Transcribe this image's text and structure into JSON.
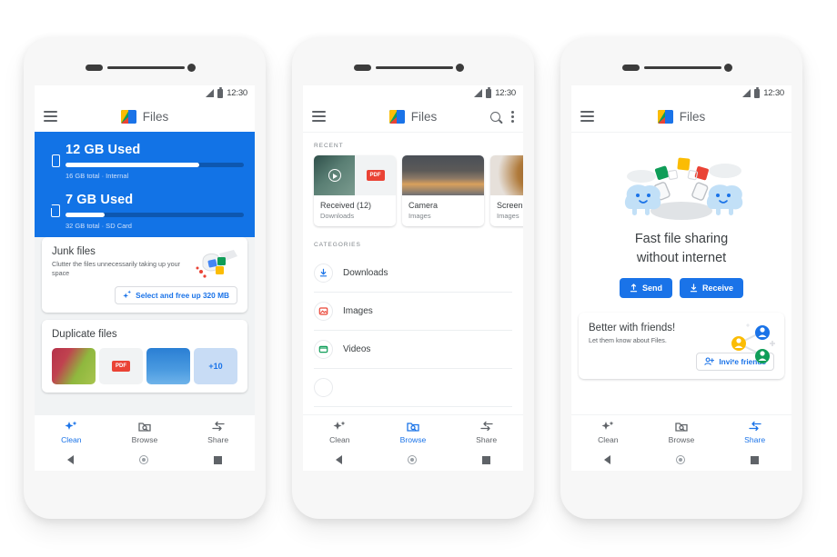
{
  "app": {
    "name": "Files",
    "logo_icon": "files-logo-icon",
    "status": {
      "time": "12:30",
      "signal_icon": "signal-icon",
      "battery_icon": "battery-icon"
    },
    "colors": {
      "brand_blue": "#1a73e8",
      "hero_blue": "#1273e6",
      "bar_track": "#0d57b0",
      "text_primary": "#3c4043",
      "text_secondary": "#5f6368",
      "surface": "#f1f3f4"
    },
    "bottom_nav": [
      {
        "label": "Clean",
        "icon": "sparkle-icon"
      },
      {
        "label": "Browse",
        "icon": "folder-search-icon"
      },
      {
        "label": "Share",
        "icon": "share-arrows-icon"
      }
    ],
    "system_nav": [
      {
        "name": "back",
        "icon": "triangle-back-icon"
      },
      {
        "name": "home",
        "icon": "circle-home-icon"
      },
      {
        "name": "recents",
        "icon": "square-recents-icon"
      }
    ]
  },
  "phone1": {
    "active_tab": "Clean",
    "menu_icon": "hamburger-menu-icon",
    "storage": [
      {
        "icon": "phone-storage-icon",
        "title": "12 GB Used",
        "subtitle": "16 GB total · Internal",
        "used_gb": 12,
        "total_gb": 16,
        "percent": 75
      },
      {
        "icon": "sd-card-icon",
        "title": "7 GB Used",
        "subtitle": "32 GB total · SD Card",
        "used_gb": 7,
        "total_gb": 32,
        "percent": 22
      }
    ],
    "junk_card": {
      "title": "Junk files",
      "subtitle": "Clutter the files unnecessarily taking up your space",
      "button_label": "Select and free up 320 MB",
      "button_icon": "sparkle-icon",
      "illustration": "broom-sweeping-files-illustration"
    },
    "duplicate_card": {
      "title": "Duplicate files",
      "thumbnails": [
        {
          "kind": "photo",
          "label": ""
        },
        {
          "kind": "pdf",
          "label": "PDF"
        },
        {
          "kind": "photo",
          "label": ""
        },
        {
          "kind": "overflow",
          "label": "+10"
        }
      ]
    }
  },
  "phone2": {
    "active_tab": "Browse",
    "menu_icon": "hamburger-menu-icon",
    "search_icon": "search-icon",
    "more_icon": "more-vertical-icon",
    "recent_label": "RECENT",
    "recent": [
      {
        "title": "Received (12)",
        "subtitle": "Downloads",
        "thumb": "video-and-pdf-thumb"
      },
      {
        "title": "Camera",
        "subtitle": "Images",
        "thumb": "sunset-photo-thumb"
      },
      {
        "title": "Screen",
        "subtitle": "Images",
        "thumb": "donut-photo-thumb"
      }
    ],
    "categories_label": "CATEGORIES",
    "categories": [
      {
        "label": "Downloads",
        "icon": "download-icon",
        "color": "#1a73e8"
      },
      {
        "label": "Images",
        "icon": "image-icon",
        "color": "#ea4335"
      },
      {
        "label": "Videos",
        "icon": "video-icon",
        "color": "#0f9d58"
      }
    ]
  },
  "phone3": {
    "active_tab": "Share",
    "menu_icon": "hamburger-menu-icon",
    "illustration": "two-blobs-sharing-files-illustration",
    "headline_line1": "Fast file sharing",
    "headline_line2": "without internet",
    "buttons": [
      {
        "label": "Send",
        "icon": "upload-icon"
      },
      {
        "label": "Receive",
        "icon": "download-icon"
      }
    ],
    "friends_card": {
      "title": "Better with friends!",
      "subtitle": "Let them know about Files.",
      "button_label": "Invite friends",
      "button_icon": "person-add-icon",
      "illustration": "friends-network-illustration"
    }
  }
}
